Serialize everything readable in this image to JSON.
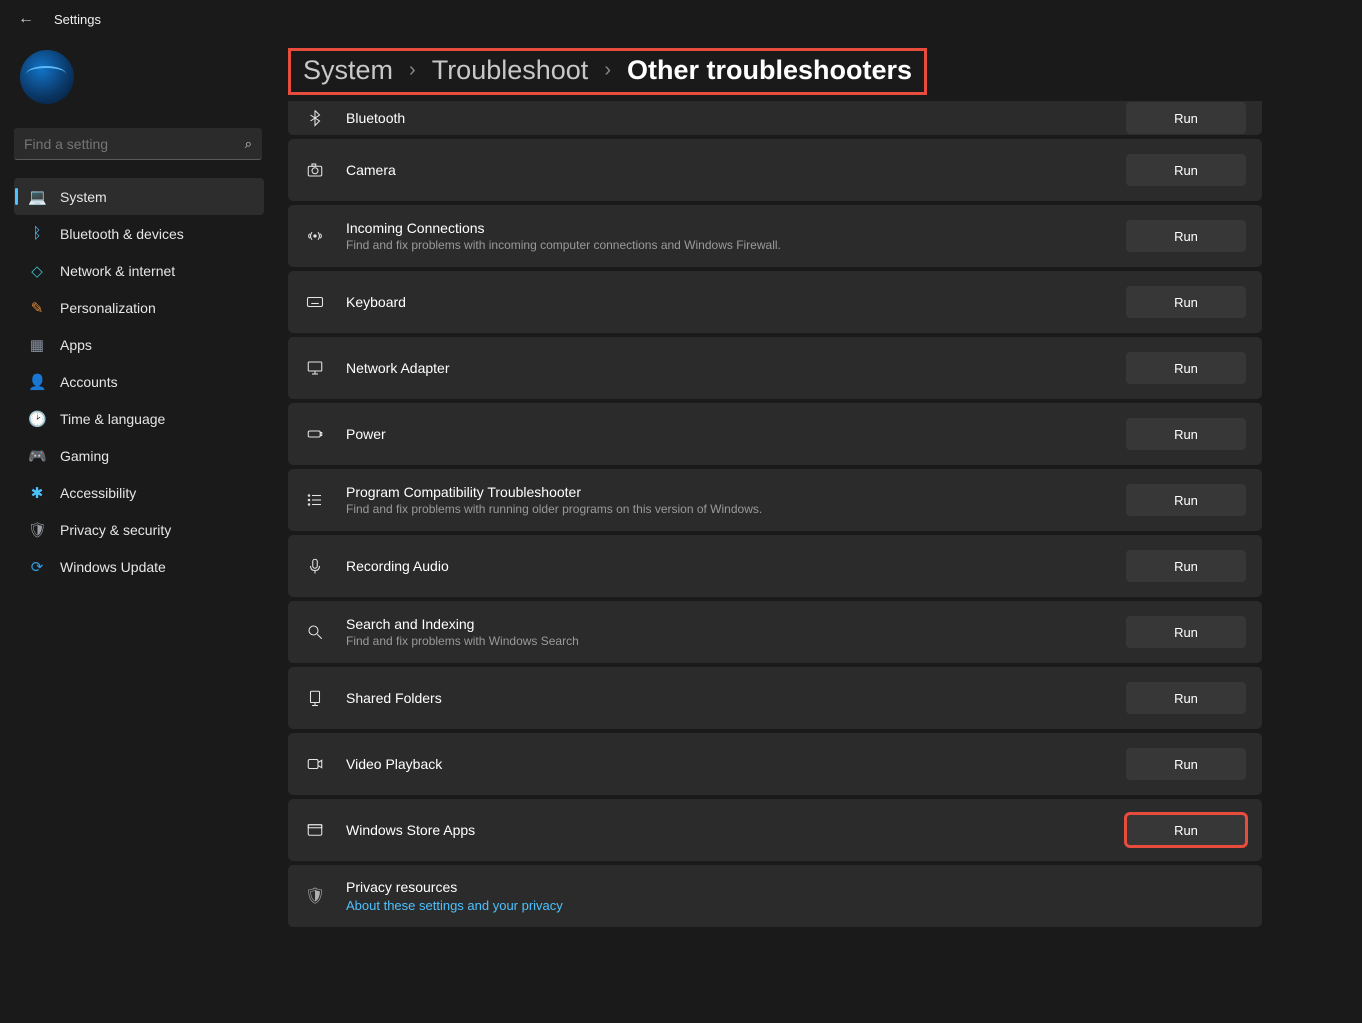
{
  "titlebar": {
    "title": "Settings"
  },
  "search": {
    "placeholder": "Find a setting"
  },
  "nav": [
    {
      "label": "System",
      "icon": "💻",
      "color": "#4cc2ff",
      "active": true
    },
    {
      "label": "Bluetooth & devices",
      "icon": "ᛒ",
      "color": "#4cc2ff"
    },
    {
      "label": "Network & internet",
      "icon": "◇",
      "color": "#38c1d0"
    },
    {
      "label": "Personalization",
      "icon": "✎",
      "color": "#e08a3c"
    },
    {
      "label": "Apps",
      "icon": "▦",
      "color": "#8a93a0"
    },
    {
      "label": "Accounts",
      "icon": "👤",
      "color": "#35c18e"
    },
    {
      "label": "Time & language",
      "icon": "🕑",
      "color": "#cfd3d8"
    },
    {
      "label": "Gaming",
      "icon": "🎮",
      "color": "#a0a0a0"
    },
    {
      "label": "Accessibility",
      "icon": "✱",
      "color": "#4cc2ff"
    },
    {
      "label": "Privacy & security",
      "icon": "🛡",
      "color": "#9aa0a6"
    },
    {
      "label": "Windows Update",
      "icon": "⟳",
      "color": "#2f9ce6"
    }
  ],
  "breadcrumb": {
    "crumb1": "System",
    "crumb2": "Troubleshoot",
    "current": "Other troubleshooters"
  },
  "troubleshooters": [
    {
      "title": "Bluetooth",
      "icon": "bluetooth",
      "run": "Run",
      "cut": true
    },
    {
      "title": "Camera",
      "icon": "camera",
      "run": "Run"
    },
    {
      "title": "Incoming Connections",
      "icon": "signal",
      "run": "Run",
      "desc": "Find and fix problems with incoming computer connections and Windows Firewall."
    },
    {
      "title": "Keyboard",
      "icon": "keyboard",
      "run": "Run"
    },
    {
      "title": "Network Adapter",
      "icon": "monitor",
      "run": "Run"
    },
    {
      "title": "Power",
      "icon": "battery",
      "run": "Run"
    },
    {
      "title": "Program Compatibility Troubleshooter",
      "icon": "list",
      "run": "Run",
      "desc": "Find and fix problems with running older programs on this version of Windows."
    },
    {
      "title": "Recording Audio",
      "icon": "mic",
      "run": "Run"
    },
    {
      "title": "Search and Indexing",
      "icon": "search",
      "run": "Run",
      "desc": "Find and fix problems with Windows Search"
    },
    {
      "title": "Shared Folders",
      "icon": "folder",
      "run": "Run"
    },
    {
      "title": "Video Playback",
      "icon": "video",
      "run": "Run"
    },
    {
      "title": "Windows Store Apps",
      "icon": "app",
      "run": "Run",
      "highlight": true
    }
  ],
  "privacy": {
    "title": "Privacy resources",
    "link": "About these settings and your privacy"
  }
}
